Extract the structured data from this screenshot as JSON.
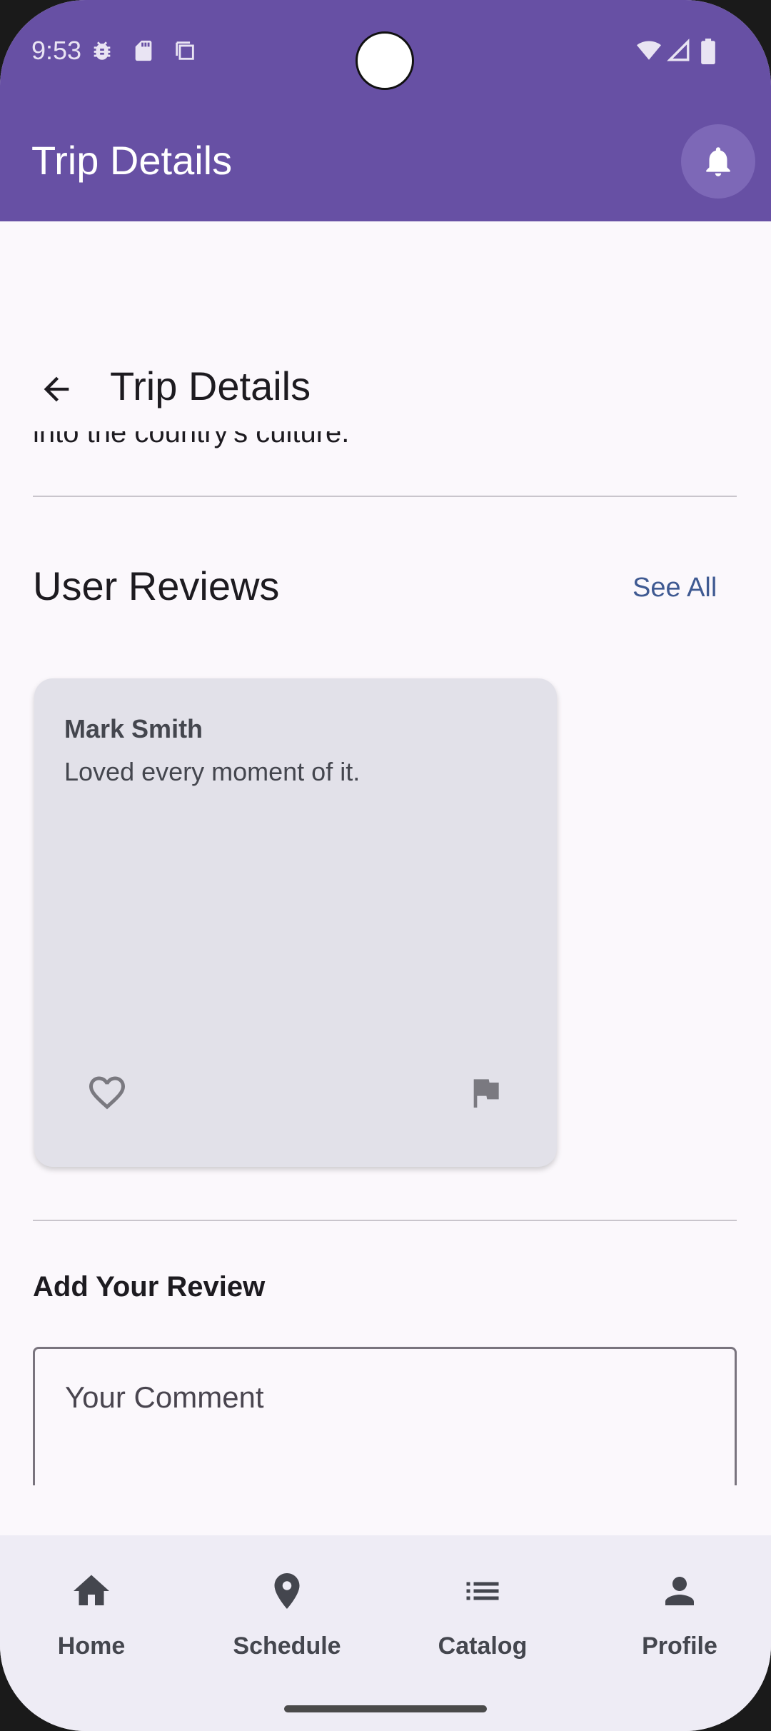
{
  "status_bar": {
    "time": "9:53",
    "icons": [
      "bug-icon",
      "sd-card-icon",
      "screenshot-icon",
      "wifi-icon",
      "signal-icon",
      "battery-icon"
    ]
  },
  "app_bar": {
    "title": "Trip Details",
    "notification_icon": "bell-icon"
  },
  "page": {
    "title": "Trip Details",
    "back_icon": "arrow-left-icon",
    "clipped_text": "into the country's culture."
  },
  "reviews": {
    "section_title": "User Reviews",
    "see_all_label": "See All",
    "items": [
      {
        "author": "Mark Smith",
        "text": "Loved every moment of it.",
        "like_icon": "heart-outline-icon",
        "flag_icon": "flag-icon"
      }
    ]
  },
  "add_review": {
    "title": "Add Your Review",
    "comment_placeholder": "Your Comment"
  },
  "bottom_nav": {
    "items": [
      {
        "label": "Home",
        "icon": "home-icon"
      },
      {
        "label": "Schedule",
        "icon": "location-pin-icon"
      },
      {
        "label": "Catalog",
        "icon": "list-icon"
      },
      {
        "label": "Profile",
        "icon": "person-icon"
      }
    ]
  },
  "colors": {
    "primary": "#6750a4",
    "link": "#3f5a92",
    "card": "#e2e1e9",
    "nav_background": "#eeecf5"
  }
}
